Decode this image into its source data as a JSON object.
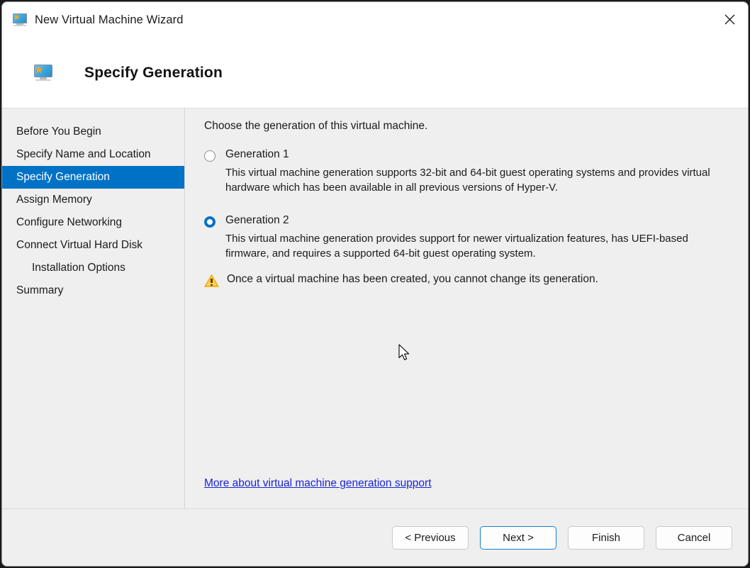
{
  "window": {
    "title": "New Virtual Machine Wizard",
    "title_icon": "virtual-machine-monitor-icon",
    "close_label": "✕"
  },
  "header": {
    "title": "Specify Generation",
    "icon": "virtual-machine-monitor-icon"
  },
  "sidebar": {
    "items": [
      {
        "label": "Before You Begin",
        "selected": false,
        "indent": false
      },
      {
        "label": "Specify Name and Location",
        "selected": false,
        "indent": false
      },
      {
        "label": "Specify Generation",
        "selected": true,
        "indent": false
      },
      {
        "label": "Assign Memory",
        "selected": false,
        "indent": false
      },
      {
        "label": "Configure Networking",
        "selected": false,
        "indent": false
      },
      {
        "label": "Connect Virtual Hard Disk",
        "selected": false,
        "indent": false
      },
      {
        "label": "Installation Options",
        "selected": false,
        "indent": true
      },
      {
        "label": "Summary",
        "selected": false,
        "indent": false
      }
    ],
    "selected_bg": "#0072c6"
  },
  "main": {
    "intro": "Choose the generation of this virtual machine.",
    "options": [
      {
        "label": "Generation 1",
        "checked": false,
        "description": "This virtual machine generation supports 32-bit and 64-bit guest operating systems and provides virtual hardware which has been available in all previous versions of Hyper-V."
      },
      {
        "label": "Generation 2",
        "checked": true,
        "description": "This virtual machine generation provides support for newer virtualization features, has UEFI-based firmware, and requires a supported 64-bit guest operating system."
      }
    ],
    "warning": {
      "icon": "warning-triangle-icon",
      "text": "Once a virtual machine has been created, you cannot change its generation."
    },
    "link": {
      "text": "More about virtual machine generation support",
      "color": "#1924d6"
    }
  },
  "footer": {
    "buttons": [
      {
        "label": "< Previous",
        "focused": false
      },
      {
        "label": "Next >",
        "focused": true
      },
      {
        "label": "Finish",
        "focused": false
      },
      {
        "label": "Cancel",
        "focused": false
      }
    ]
  }
}
